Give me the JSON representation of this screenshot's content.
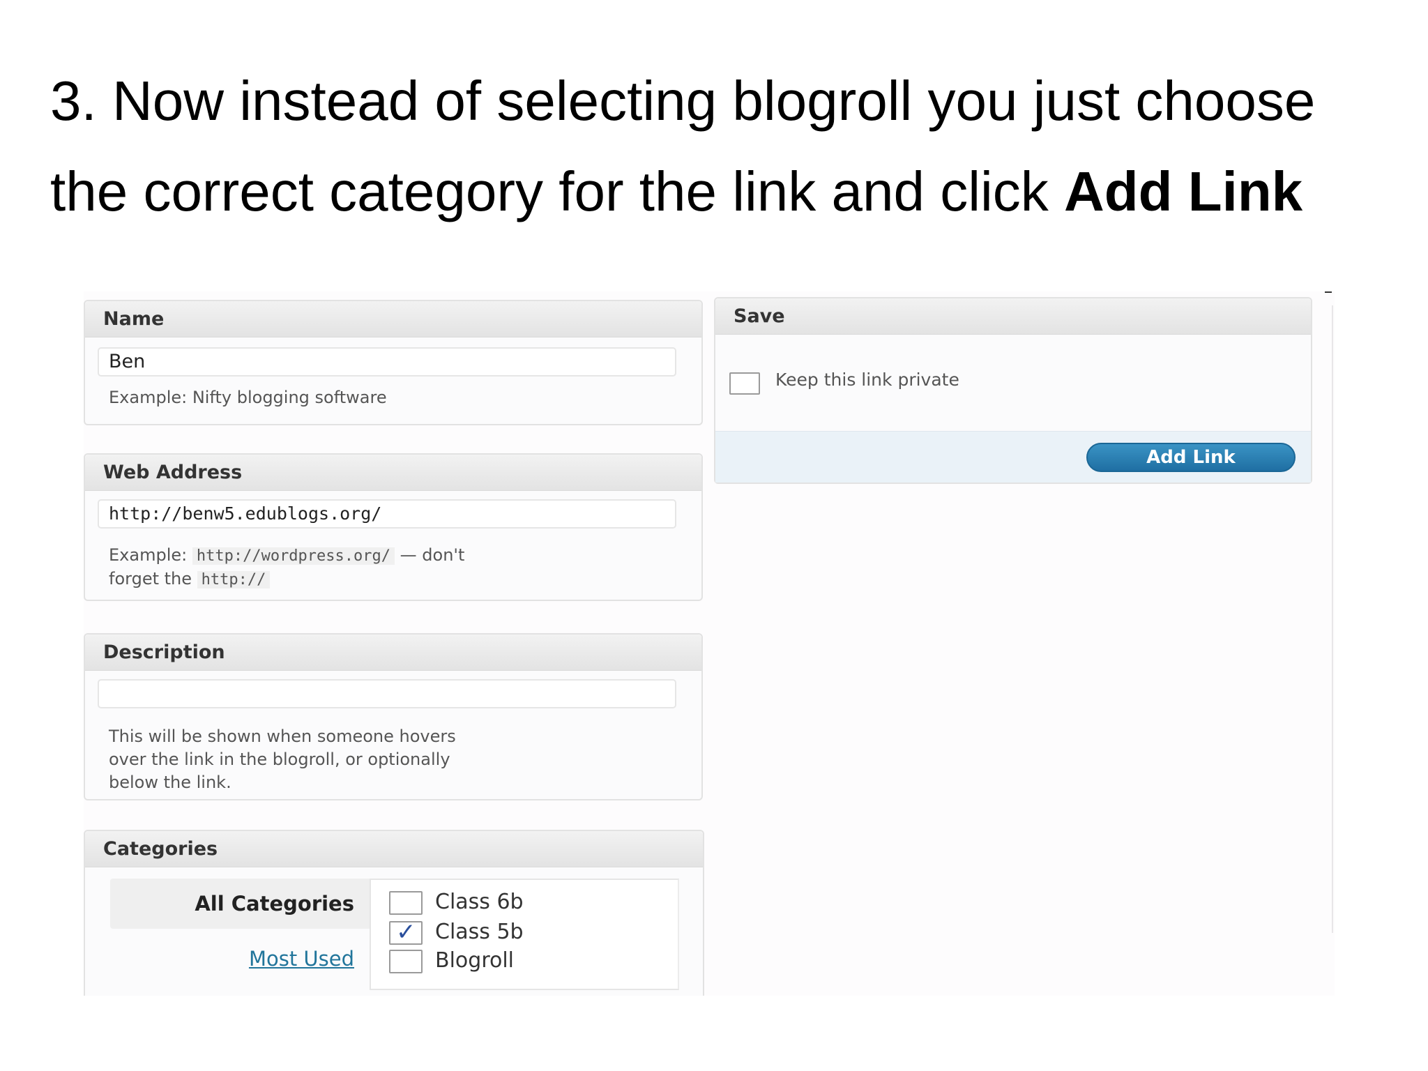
{
  "instruction": {
    "line1": "3.  Now instead of selecting blogroll you just choose",
    "line2_prefix": "the correct category for the link and click ",
    "line2_bold": "Add Link"
  },
  "name_box": {
    "title": "Name",
    "value": "Ben",
    "hint": "Example: Nifty blogging software"
  },
  "web_address_box": {
    "title": "Web Address",
    "value": "http://benw5.edublogs.org/",
    "hint_prefix": "Example:",
    "hint_code1": "http://wordpress.org/",
    "hint_mid": "— don't",
    "hint_line2_prefix": "forget the",
    "hint_code2": "http://"
  },
  "description_box": {
    "title": "Description",
    "value": "",
    "hint_line1": "This will be shown when someone hovers",
    "hint_line2": "over the link in the blogroll, or optionally",
    "hint_line3": "below the link."
  },
  "categories_box": {
    "title": "Categories",
    "tabs": [
      {
        "label": "All Categories",
        "active": true
      },
      {
        "label": "Most Used",
        "active": false
      }
    ],
    "items": [
      {
        "label": "Class 6b",
        "checked": false
      },
      {
        "label": "Class 5b",
        "checked": true
      },
      {
        "label": "Blogroll",
        "checked": false
      }
    ]
  },
  "save_box": {
    "title": "Save",
    "private_label": "Keep this link private",
    "private_checked": false,
    "add_link_label": "Add Link"
  },
  "colors": {
    "accent_button": "#21759b",
    "link": "#21759b",
    "footer_bg": "#eaf2f8"
  }
}
